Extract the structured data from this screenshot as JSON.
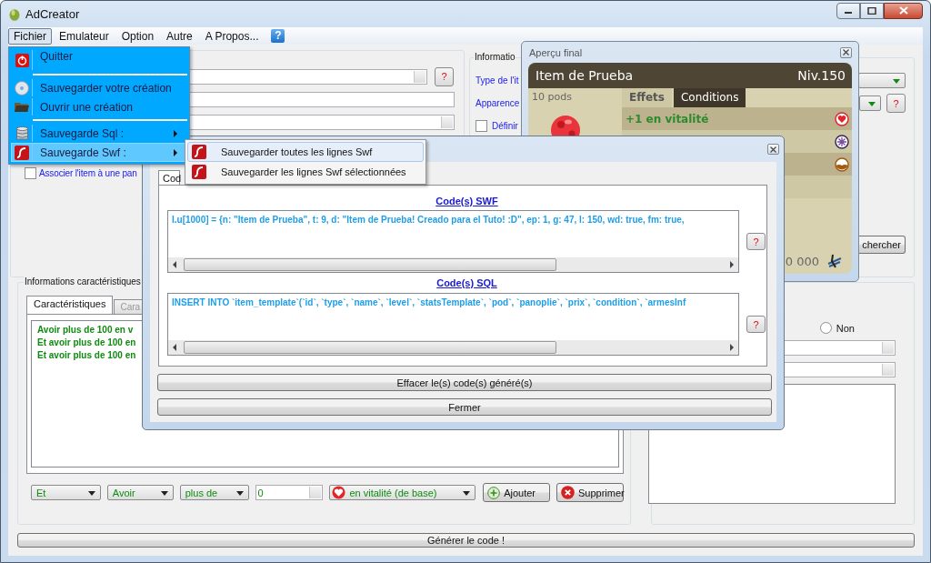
{
  "window": {
    "title": "AdCreator"
  },
  "menu_bar": {
    "items": [
      {
        "label": "Fichier",
        "selected": true
      },
      {
        "label": "Emulateur",
        "selected": false
      },
      {
        "label": "Option",
        "selected": false
      },
      {
        "label": "Autre",
        "selected": false
      },
      {
        "label": "A Propos...",
        "selected": false
      }
    ],
    "help": "?"
  },
  "file_menu": {
    "groups": [
      [
        {
          "label": "Quitter",
          "submenu": false,
          "selected": false
        }
      ],
      [
        {
          "label": "Sauvegarder votre création",
          "submenu": false,
          "selected": false
        },
        {
          "label": "Ouvrir une création",
          "submenu": false,
          "selected": false
        }
      ],
      [
        {
          "label": "Sauvegarde Sql :",
          "submenu": true,
          "selected": false
        },
        {
          "label": "Sauvegarde Swf :",
          "submenu": true,
          "selected": true
        }
      ]
    ]
  },
  "swf_submenu": {
    "items": [
      {
        "label": "Sauvegarder toutes les lignes Swf",
        "selected": true
      },
      {
        "label": "Sauvegarder les lignes Swf sélectionnées",
        "selected": false
      }
    ]
  },
  "item_panel": {
    "help": "?",
    "checkbox": {
      "label": "Associer l'item à une pan",
      "checked": false
    }
  },
  "info_panel": {
    "title": "Informatio",
    "labels": [
      "Type de l'it",
      "Apparence"
    ],
    "checkbox": {
      "label": "Définir",
      "checked": false
    },
    "help": "?",
    "search_button": "chercher"
  },
  "preview": {
    "title": "Aperçu final",
    "item_name": "Item de Prueba",
    "level": "Niv.150",
    "weight": "10 pods",
    "tabs": [
      {
        "label": "Effets",
        "selected": true
      },
      {
        "label": "Conditions",
        "selected": false
      }
    ],
    "effects": [
      "+1 en vitalité"
    ],
    "price": "0 000"
  },
  "characteristics": {
    "title": "Informations caractéristiques",
    "tabs": [
      {
        "label": "Caractéristiques",
        "selected": true
      },
      {
        "label": "Cara",
        "selected": false
      }
    ],
    "conditions": [
      "Avoir plus de 100 en v",
      "Et avoir plus de 100 en",
      "Et avoir plus de 100 en"
    ],
    "selectors": [
      "Et",
      "Avoir",
      "plus de"
    ],
    "amount": "0",
    "stat": "en vitalité (de base)",
    "add_button": "Ajouter",
    "delete_button": "Supprimer"
  },
  "options_panel": {
    "radio": {
      "label": "Non",
      "selected": false
    }
  },
  "code_dialog": {
    "tab": "Cod",
    "sections": [
      {
        "heading": "Code(s) SWF",
        "code": "I.u[1000] = {n: \"Item de Prueba\", t: 9, d: \"Item de Prueba! Creado para el Tuto! :D\", ep: 1, g: 47, l: 150, wd: true, fm: true,",
        "help": "?"
      },
      {
        "heading": "Code(s) SQL",
        "code": "INSERT INTO `item_template`(`id`, `type`, `name`, `level`, `statsTemplate`, `pod`, `panoplie`, `prix`, `condition`, `armesInf",
        "help": "?"
      }
    ],
    "buttons": [
      "Effacer le(s) code(s) généré(s)",
      "Fermer"
    ]
  },
  "generate_button": "Générer le code !"
}
